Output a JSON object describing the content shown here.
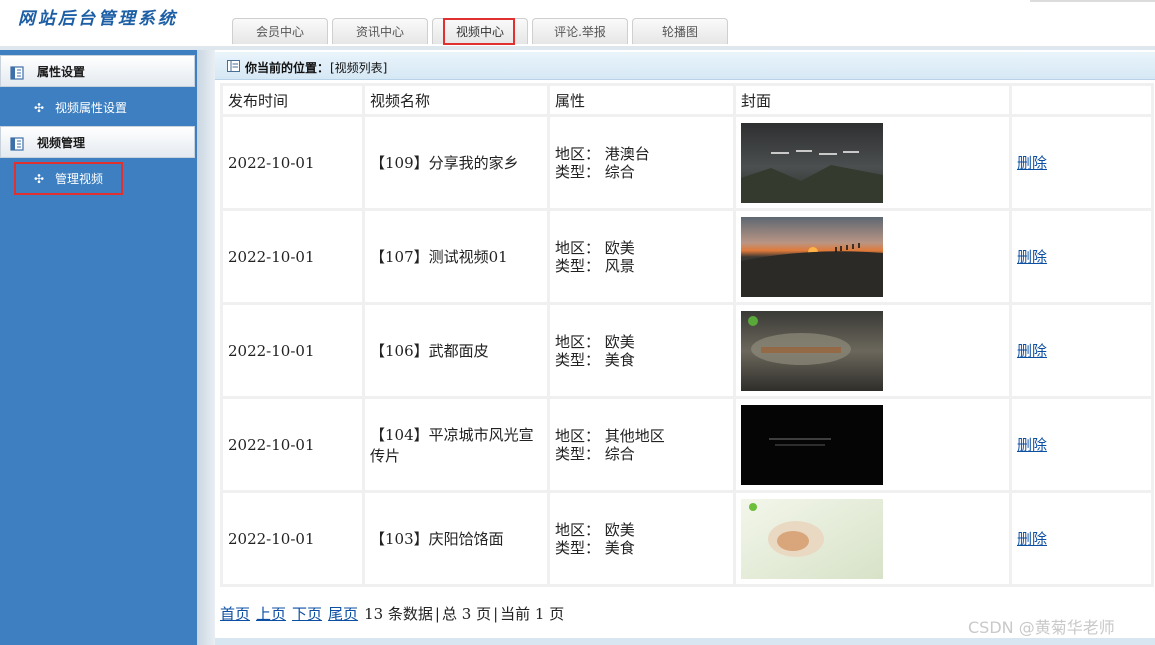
{
  "header": {
    "logo": "网站后台管理系统",
    "tabs": [
      {
        "label": "会员中心",
        "active": false
      },
      {
        "label": "资讯中心",
        "active": false
      },
      {
        "label": "视频中心",
        "active": true
      },
      {
        "label": "评论.举报",
        "active": false
      },
      {
        "label": "轮播图",
        "active": false
      }
    ]
  },
  "sidebar": {
    "groups": [
      {
        "title": "属性设置",
        "icon": "document-icon",
        "items": [
          {
            "label": "视频属性设置"
          }
        ]
      },
      {
        "title": "视频管理",
        "icon": "document-icon",
        "items": [
          {
            "label": "管理视频",
            "selected": true
          }
        ]
      }
    ]
  },
  "breadcrumb": {
    "label": "你当前的位置：",
    "value": "[视频列表]"
  },
  "table": {
    "headers": [
      "发布时间",
      "视频名称",
      "属性",
      "封面",
      ""
    ],
    "region_label": "地区：",
    "type_label": "类型：",
    "delete_label": "删除",
    "rows": [
      {
        "date": "2022-10-01",
        "name": "【109】分享我的家乡",
        "region": "港澳台",
        "type": "综合",
        "cover": "cover-mountain-title"
      },
      {
        "date": "2022-10-01",
        "name": "【107】测试视频01",
        "region": "欧美",
        "type": "风景",
        "cover": "cover-sunset"
      },
      {
        "date": "2022-10-01",
        "name": "【106】武都面皮",
        "region": "欧美",
        "type": "美食",
        "cover": "cover-noodle-dark"
      },
      {
        "date": "2022-10-01",
        "name": "【104】平凉城市风光宣传片",
        "region": "其他地区",
        "type": "综合",
        "cover": "cover-black-text"
      },
      {
        "date": "2022-10-01",
        "name": "【103】庆阳饸饹面",
        "region": "欧美",
        "type": "美食",
        "cover": "cover-noodle-light"
      }
    ]
  },
  "pager": {
    "first": "首页",
    "prev": "上页",
    "next": "下页",
    "last": "尾页",
    "records": "13 条数据",
    "total_pages": "总 3 页",
    "current_page": "当前 1 页"
  },
  "watermark": "CSDN @黄菊华老师",
  "colors": {
    "sidebar": "#3d7fc0",
    "highlight": "#e03030",
    "link": "#0d4fa3"
  }
}
